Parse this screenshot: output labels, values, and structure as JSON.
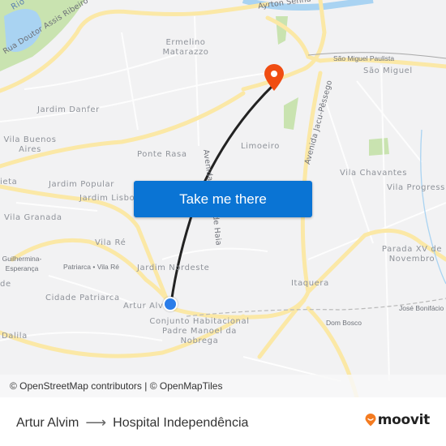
{
  "map": {
    "cta_label": "Take me there",
    "attribution": "© OpenStreetMap contributors | © OpenMapTiles",
    "origin_marker": "Artur Alvim",
    "destination_marker": "Hospital Independência",
    "colors": {
      "land": "#f2f2f3",
      "major_road": "#fbe8a6",
      "park": "#c9e3b0",
      "water": "#a9d3f2",
      "route": "#222222",
      "origin": "#2b7de9",
      "destination": "#f04d12",
      "cta": "#0a74d4"
    },
    "labels": {
      "rio": "Rio",
      "ayrton_senna": "Ayrton Senna",
      "rua_assis": "Rua Doutor Assis Ribeiro",
      "ermelino": "Ermelino Matarazzo",
      "sao_miguel_paulista": "São Miguel Paulista",
      "sao_miguel": "São Miguel",
      "jardim_danfer": "Jardim Danfer",
      "av_jacu": "Avenida Jacu-Pêssego",
      "vila_buenos": "Vila Buenos Aires",
      "ponte_rasa": "Ponte Rasa",
      "avenida_haia": "Avenida",
      "haia": "de Haia",
      "limoeiro": "Limoeiro",
      "jardim_popular": "Jardim Popular",
      "vila_chavantes": "Vila Chavantes",
      "vieta": "ieta",
      "jardim_lisboa": "Jardim Lisbo",
      "vila_progresso": "Vila Progress",
      "vila_granada": "Vila Granada",
      "vila_re": "Vila Ré",
      "parada_xv": "Parada XV de Novembro",
      "guilhermina": "Guilhermina-Esperança",
      "patriarca": "Patriarca • Vila Ré",
      "jardim_nordeste": "Jardim Nordeste",
      "de": "de",
      "itaquera": "Itaquera",
      "cidade_patriarca": "Cidade Patriarca",
      "artur_alvim": "Artur Alv",
      "jose_bonifacio": "José Bonifácio",
      "conjunto": "Conjunto Habitacional Padre Manoel da Nobrega",
      "dom_bosco": "Dom Bosco",
      "dalila": "Dalila"
    }
  },
  "footer": {
    "origin": "Artur Alvim",
    "arrow": "⟶",
    "destination": "Hospital Independência",
    "brand": "moovit"
  }
}
